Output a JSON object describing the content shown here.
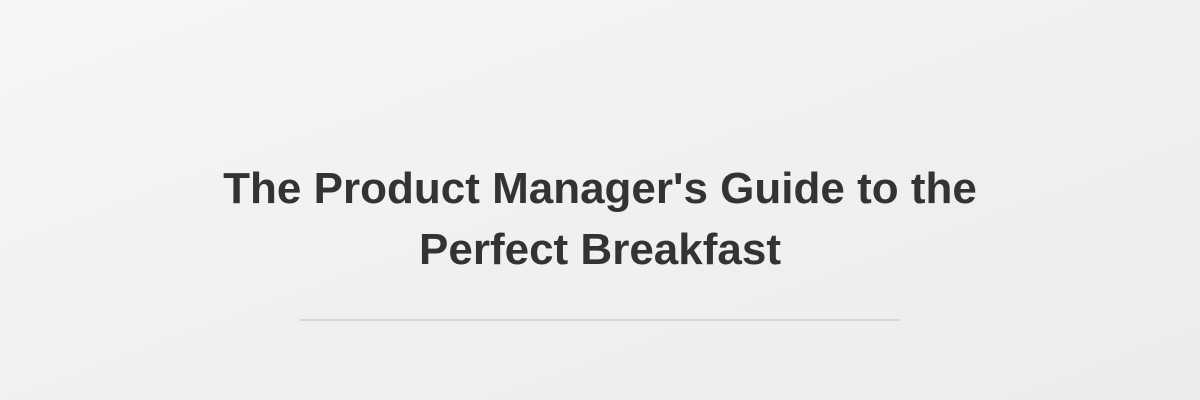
{
  "banner": {
    "title": "The Product Manager's Guide to the Perfect Breakfast"
  },
  "colors": {
    "background": "#f2f2f2",
    "title_text": "#333333",
    "divider": "#d6d6d6"
  }
}
